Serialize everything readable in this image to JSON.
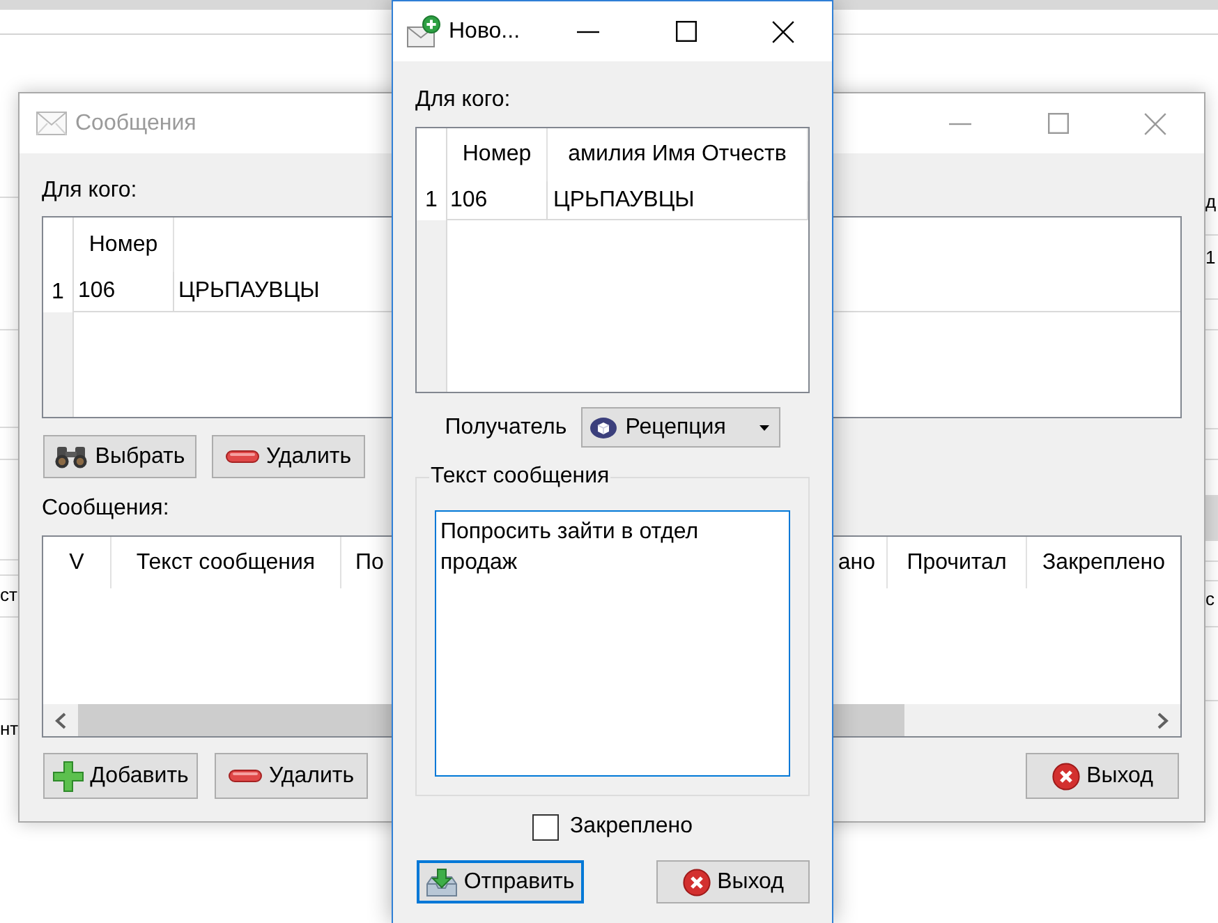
{
  "background_app": {
    "left_cells": [
      "ст",
      "нт"
    ],
    "right_cells": [
      "д",
      "1",
      "с"
    ]
  },
  "messages_window": {
    "title": "Сообщения",
    "active": false,
    "recipients_label": "Для кого:",
    "recipients_table": {
      "columns": [
        "Номер"
      ],
      "rows": [
        {
          "number": "1",
          "cells": [
            "106",
            "ЦРЬПАУВЦЫ"
          ]
        }
      ]
    },
    "recipient_buttons": [
      {
        "kind": "pick",
        "label": "Выбрать"
      },
      {
        "kind": "delete",
        "label": "Удалить"
      }
    ],
    "messages_label": "Сообщения:",
    "messages_table": {
      "columns_left": [
        "V",
        "Текст сообщения",
        "По"
      ],
      "columns_right": [
        "ано",
        "Прочитал",
        "Закреплено"
      ]
    },
    "buttons": [
      {
        "kind": "add",
        "label": "Добавить"
      },
      {
        "kind": "delete",
        "label": "Удалить"
      },
      {
        "kind": "exit",
        "label": "Выход"
      }
    ]
  },
  "new_message_dialog": {
    "title": "Ново...",
    "active": true,
    "recipients_label": "Для кого:",
    "recipients_table": {
      "columns": [
        "Номер",
        "амилия Имя Отчеств"
      ],
      "rows": [
        {
          "number": "1",
          "cells": [
            "106",
            "ЦРЬПАУВЦЫ"
          ]
        }
      ]
    },
    "recipient_type": {
      "label": "Получатель",
      "value": "Рецепция"
    },
    "message_group": {
      "title": "Текст сообщения",
      "value": "Попросить зайти в отдел продаж"
    },
    "pinned": {
      "label": "Закреплено",
      "checked": false
    },
    "buttons": [
      {
        "kind": "send",
        "label": "Отправить",
        "default": true
      },
      {
        "kind": "exit",
        "label": "Выход",
        "default": false
      }
    ]
  }
}
